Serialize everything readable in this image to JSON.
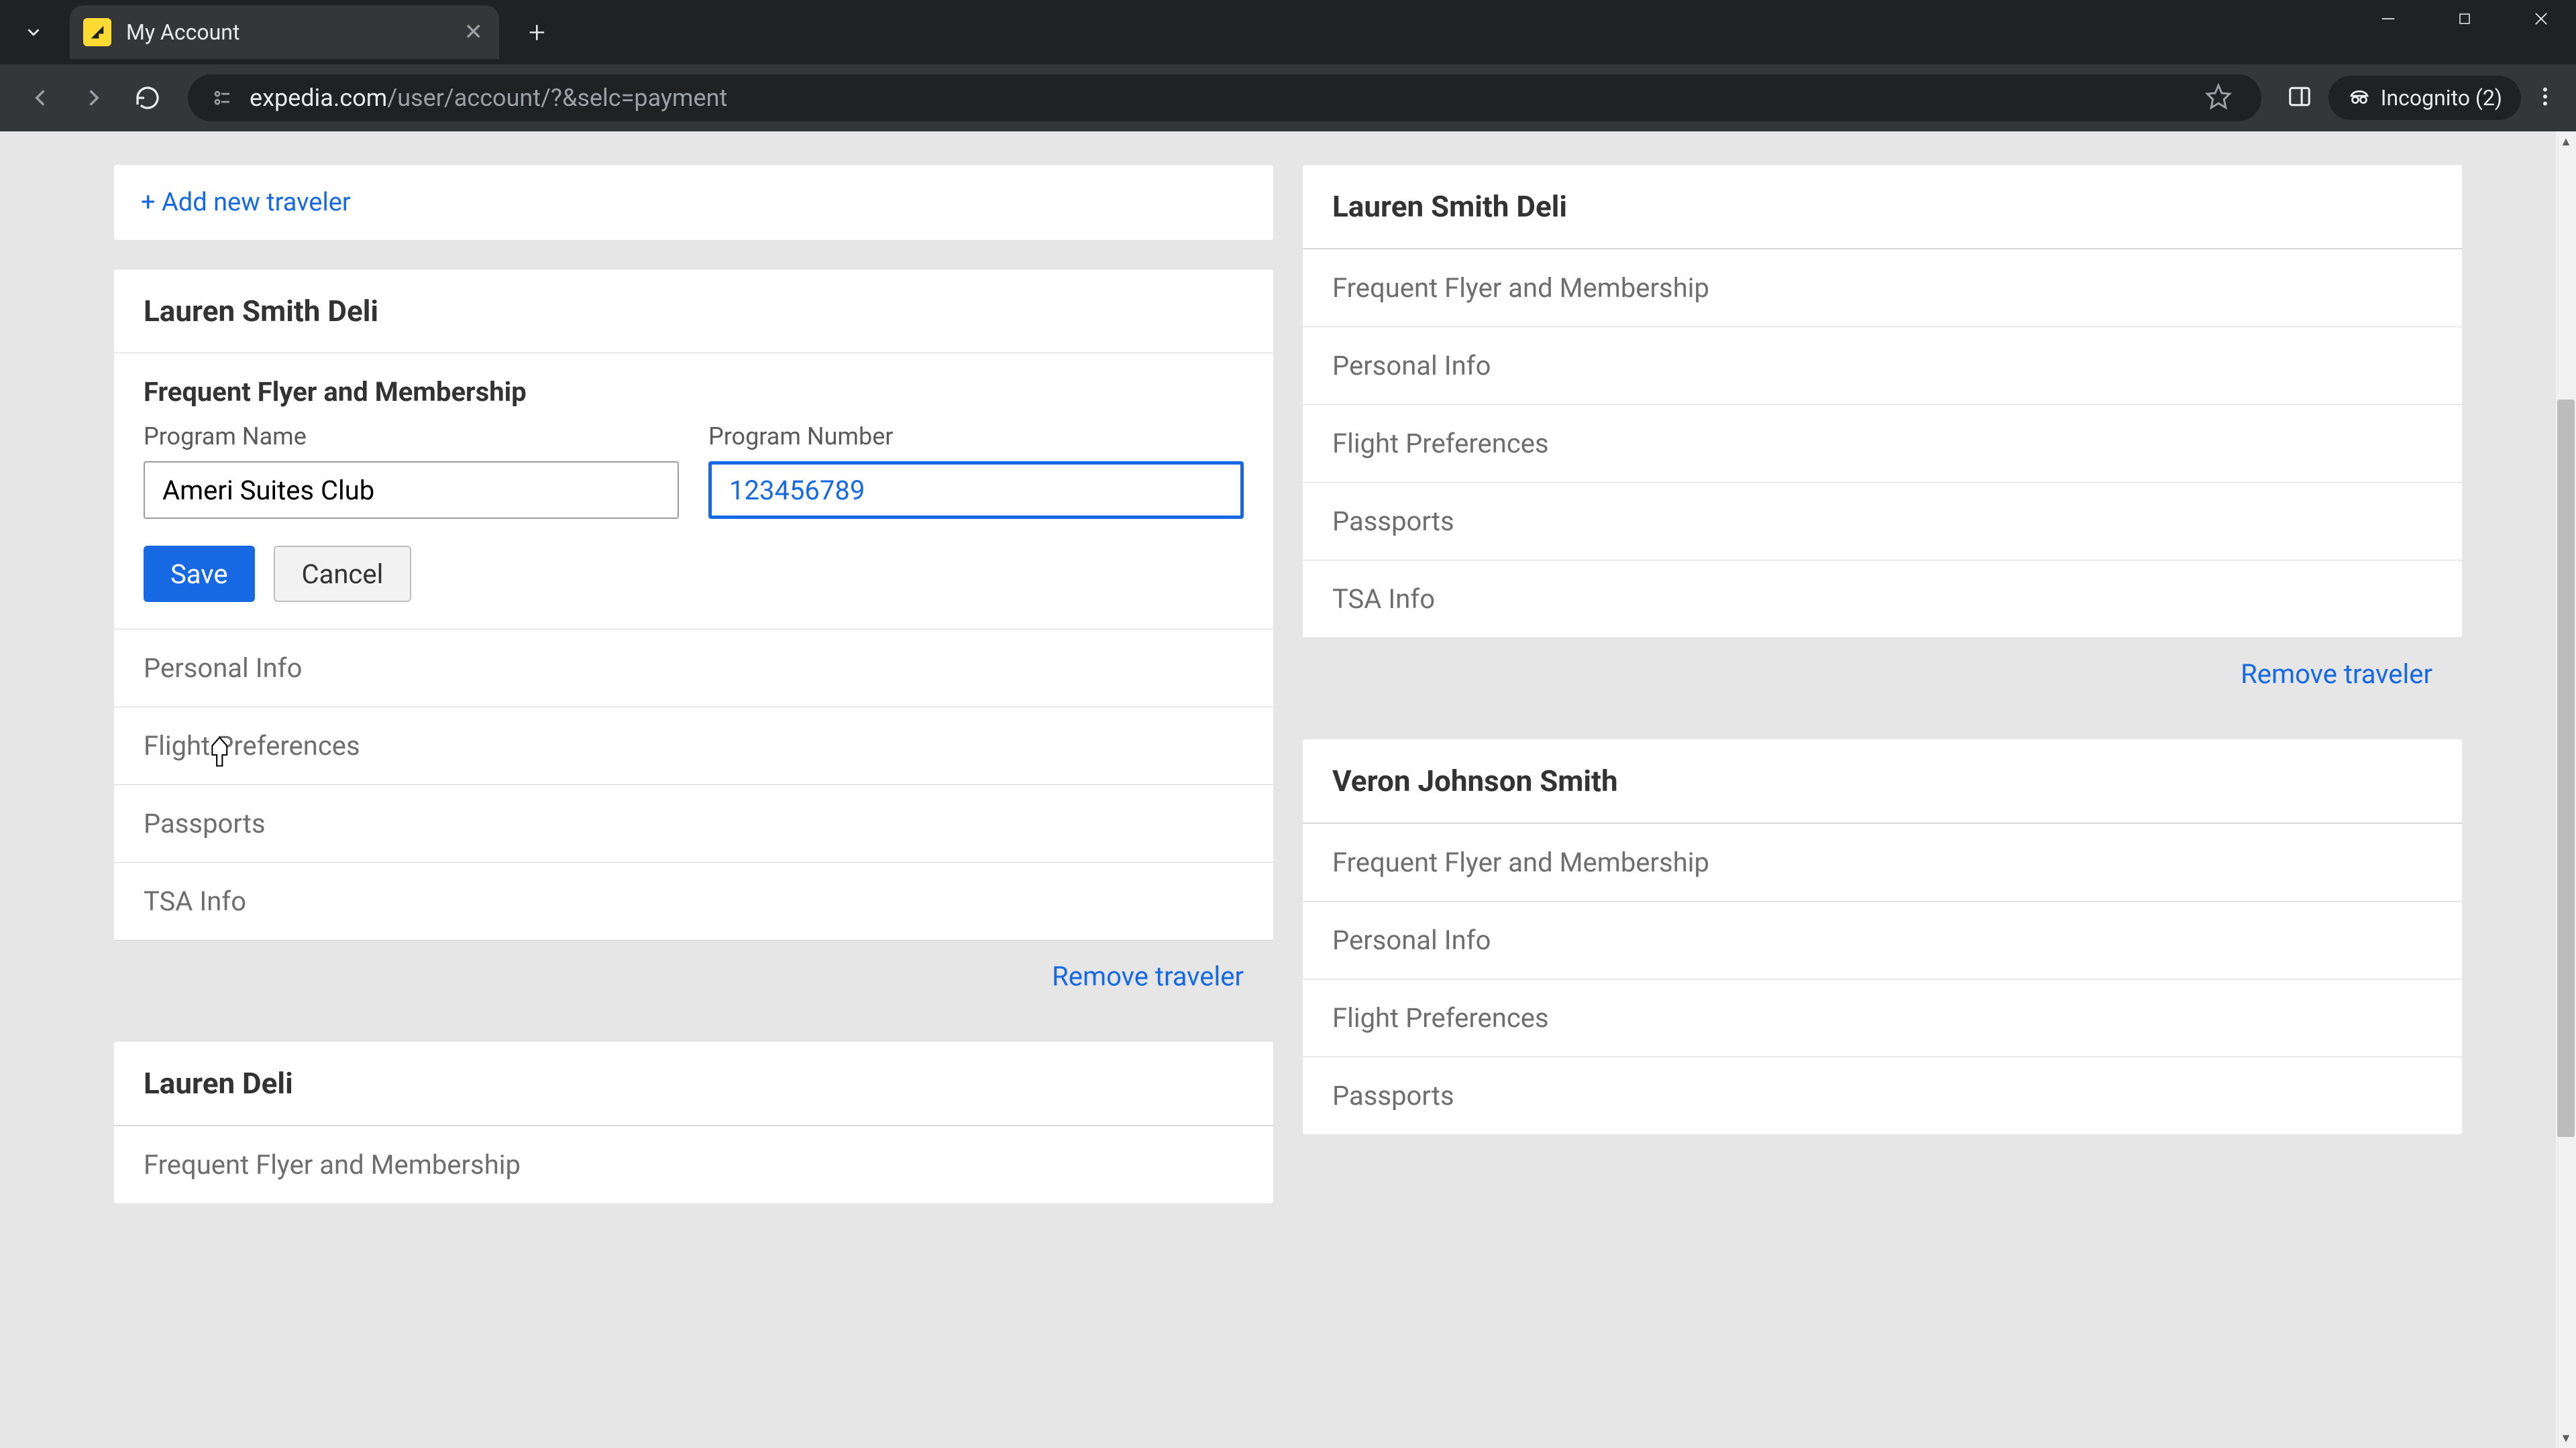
{
  "browser": {
    "tab_title": "My Account",
    "url_domain": "expedia.com",
    "url_path": "/user/account/?&selc=payment",
    "incognito_label": "Incognito (2)"
  },
  "page": {
    "add_link": "+ Add new traveler",
    "remove_link": "Remove traveler",
    "save_label": "Save",
    "cancel_label": "Cancel",
    "form": {
      "section_title": "Frequent Flyer and Membership",
      "program_name_label": "Program Name",
      "program_name_value": "Ameri Suites Club",
      "program_number_label": "Program Number",
      "program_number_value": "123456789"
    },
    "sections": {
      "frequent_flyer": "Frequent Flyer and Membership",
      "personal_info": "Personal Info",
      "flight_prefs": "Flight Preferences",
      "passports": "Passports",
      "tsa": "TSA Info"
    },
    "travelers": {
      "t1": "Lauren Smith Deli",
      "t2": "Lauren Smith Deli",
      "t3": "Lauren Deli",
      "t4": "Veron Johnson Smith"
    }
  }
}
